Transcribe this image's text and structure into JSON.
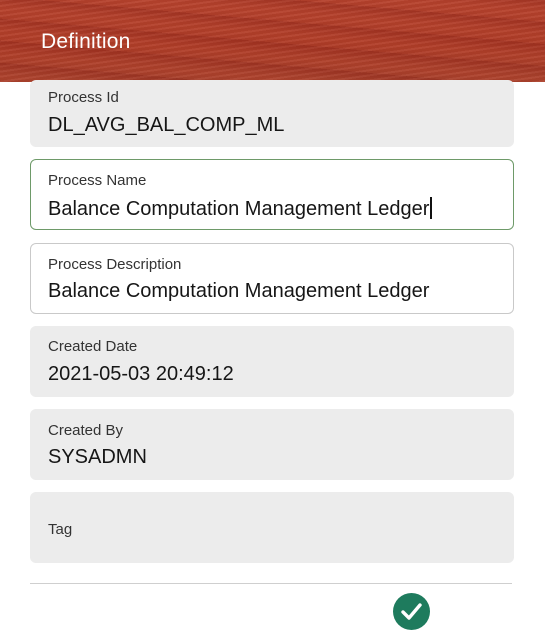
{
  "header": {
    "title": "Definition"
  },
  "fields": {
    "process_id": {
      "label": "Process Id",
      "value": "DL_AVG_BAL_COMP_ML"
    },
    "process_name": {
      "label": "Process Name",
      "value": "Balance Computation Management Ledger"
    },
    "process_description": {
      "label": "Process Description",
      "value": "Balance Computation Management Ledger"
    },
    "created_date": {
      "label": "Created Date",
      "value": "2021-05-03 20:49:12"
    },
    "created_by": {
      "label": "Created By",
      "value": "SYSADMN"
    },
    "tag": {
      "label": "Tag",
      "value": ""
    }
  },
  "actions": {
    "confirm_icon": "checkmark-icon"
  },
  "colors": {
    "header_bg": "#ae3b27",
    "readonly_bg": "#ececec",
    "active_border": "#6e9a69",
    "confirm_bg": "#1e7b5d"
  }
}
